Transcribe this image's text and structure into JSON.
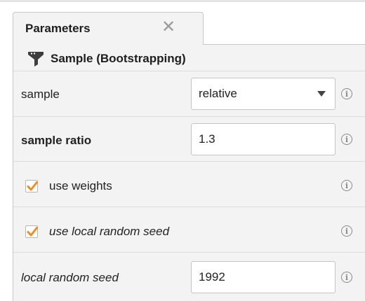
{
  "tab": {
    "title": "Parameters",
    "close_glyph": "✕"
  },
  "operator": {
    "title": "Sample (Bootstrapping)",
    "icon": "funnel-icon"
  },
  "params": {
    "sample": {
      "label": "sample",
      "value": "relative"
    },
    "sample_ratio": {
      "label": "sample ratio",
      "value": "1.3"
    },
    "use_weights": {
      "label": "use weights",
      "checked": true
    },
    "use_local_random_seed": {
      "label": "use local random seed",
      "checked": true
    },
    "local_random_seed": {
      "label": "local random seed",
      "value": "1992"
    }
  },
  "info_glyph": "i",
  "colors": {
    "checkmark": "#f28c1e",
    "icon": "#3e3e3e"
  }
}
